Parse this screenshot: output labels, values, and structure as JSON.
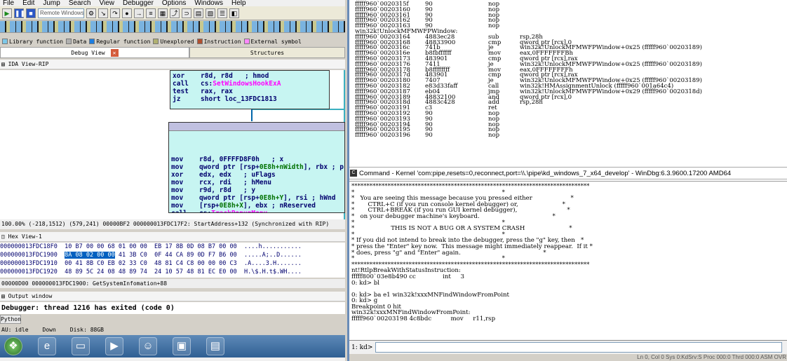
{
  "ida": {
    "menu": [
      "File",
      "Edit",
      "Jump",
      "Search",
      "View",
      "Debugger",
      "Options",
      "Windows",
      "Help"
    ],
    "debugger_select": "Remote Windows debugger",
    "legend": [
      {
        "label": "Library function",
        "color": "#7ec8e8"
      },
      {
        "label": "Data",
        "color": "#b0b0b0"
      },
      {
        "label": "Regular function",
        "color": "#1e7ee0"
      },
      {
        "label": "Unexplored",
        "color": "#b0b070"
      },
      {
        "label": "Instruction",
        "color": "#b05030"
      },
      {
        "label": "External symbol",
        "color": "#ff88ff"
      }
    ],
    "tabs": {
      "debug_view": "Debug View",
      "structures": "Structures",
      "close_glyph": "✕"
    },
    "ida_view_title": "IDA View-RIP",
    "block1": [
      {
        "op": "xor",
        "args": "r8d, r8d",
        "comment": "; hmod"
      },
      {
        "op": "call",
        "args": "cs:",
        "fn": "SetWindowsHookExA"
      },
      {
        "op": "test",
        "args": "rax, rax"
      },
      {
        "op": "jz",
        "args": "short loc_13FDC1813"
      }
    ],
    "block2": [
      {
        "op": "mov",
        "args": "r8d, 0FFFFD8F0h",
        "comment": "; x"
      },
      {
        "op": "mov",
        "args": "qword ptr [rsp+",
        "off": "0E8h+nWidth",
        "rest": "], rbx ; p"
      },
      {
        "op": "xor",
        "args": "edx, edx",
        "comment": "; uFlags"
      },
      {
        "op": "mov",
        "args": "rcx, rdi",
        "comment": "; hMenu"
      },
      {
        "op": "mov",
        "args": "r9d, r8d",
        "comment": "; y"
      },
      {
        "op": "mov",
        "args": "qword ptr [rsp+",
        "off": "0E8h+Y",
        "rest": "], rsi ; hWnd"
      },
      {
        "op": "mov",
        "args": "[rsp+",
        "off": "0E8h+X",
        "rest": "], ebx ; nReserved"
      },
      {
        "op": "call",
        "args": "cs:",
        "fn": "TrackPopupMenu"
      },
      {
        "op": "test",
        "args": "eax, eax"
      },
      {
        "op": "jz",
        "args": "short loc_13FDC1813"
      }
    ],
    "graph_status": "100.00% (-218,1512) (579,241) 00000BF2 000000013FDC17F2: StartAddress+132 (Synchronized with RIP)",
    "hex_title": "Hex View-1",
    "hex_rows": [
      {
        "addr": "000000013FDC18F0",
        "pre": "",
        "hl": "",
        "bytes": "10 B7 00 00 68 01 00 00  EB 17 8B 0D 08 B7 00 00",
        "ascii": "....h..........."
      },
      {
        "addr": "000000013FDC1900",
        "pre": "",
        "hl": "8A 08 02 00 00",
        "bytes": " 41 3B C0  0F 44 CA 89 0D F7 B6 00",
        "ascii": ".....A;..D......"
      },
      {
        "addr": "000000013FDC1910",
        "pre": "",
        "hl": "",
        "bytes": "00 41 8B C0 EB 02 33 C0  48 81 C4 C8 00 00 00 C3",
        "ascii": ".A....3.H......."
      },
      {
        "addr": "000000013FDC1920",
        "pre": "",
        "hl": "",
        "bytes": "48 89 5C 24 08 48 89 74  24 10 57 48 81 EC E0 00",
        "ascii": "H.\\$.H.t$.WH...."
      }
    ],
    "hex_status": "00000D00 000000013FDC1900: GetSystemInfomation+88",
    "output_title": "Output window",
    "output_text": "Debugger: thread 1216 has exited (code 0)",
    "python_button": "Python",
    "status": {
      "au": "AU:  idle",
      "down": "Down",
      "disk": "Disk: 88GB"
    }
  },
  "windbg": {
    "disasm": [
      {
        "addr": "fffff960`0020315f",
        "bytes": "90",
        "mn": "nop",
        "ops": ""
      },
      {
        "addr": "fffff960`00203160",
        "bytes": "90",
        "mn": "nop",
        "ops": ""
      },
      {
        "addr": "fffff960`00203161",
        "bytes": "90",
        "mn": "nop",
        "ops": ""
      },
      {
        "addr": "fffff960`00203162",
        "bytes": "90",
        "mn": "nop",
        "ops": ""
      },
      {
        "addr": "fffff960`00203163",
        "bytes": "90",
        "mn": "nop",
        "ops": ""
      },
      {
        "sym": "win32k!UnlockMFMWFPWindow:"
      },
      {
        "addr": "fffff960`00203164",
        "bytes": "4883ec28",
        "mn": "sub",
        "ops": "rsp,28h"
      },
      {
        "addr": "fffff960`00203168",
        "bytes": "48833900",
        "mn": "cmp",
        "ops": "qword ptr [rcx],0"
      },
      {
        "addr": "fffff960`0020316c",
        "bytes": "741b",
        "mn": "je",
        "ops": "win32k!UnlockMFMWFPWindow+0x25 (fffff960`00203189)"
      },
      {
        "addr": "fffff960`0020316e",
        "bytes": "b8fbffffff",
        "mn": "mov",
        "ops": "eax,0FFFFFFFBh"
      },
      {
        "addr": "fffff960`00203173",
        "bytes": "483901",
        "mn": "cmp",
        "ops": "qword ptr [rcx],rax"
      },
      {
        "addr": "fffff960`00203176",
        "bytes": "7411",
        "mn": "je",
        "ops": "win32k!UnlockMFMWFPWindow+0x25 (fffff960`00203189)"
      },
      {
        "addr": "fffff960`00203178",
        "bytes": "b8ffffffff",
        "mn": "mov",
        "ops": "eax,0FFFFFFFFh"
      },
      {
        "addr": "fffff960`0020317d",
        "bytes": "483901",
        "mn": "cmp",
        "ops": "qword ptr [rcx],rax"
      },
      {
        "addr": "fffff960`00203180",
        "bytes": "7407",
        "mn": "je",
        "ops": "win32k!UnlockMFMWFPWindow+0x25 (fffff960`00203189)"
      },
      {
        "addr": "fffff960`00203182",
        "bytes": "e83d33faff",
        "mn": "call",
        "ops": "win32k!HMAssignmentUnlock (fffff960`001a64c4)"
      },
      {
        "addr": "fffff960`00203187",
        "bytes": "eb04",
        "mn": "jmp",
        "ops": "win32k!UnlockMFMWFPWindow+0x29 (fffff960`0020318d)"
      },
      {
        "addr": "fffff960`00203189",
        "bytes": "48832100",
        "mn": "and",
        "ops": "qword ptr [rcx],0"
      },
      {
        "addr": "fffff960`0020318d",
        "bytes": "4883c428",
        "mn": "add",
        "ops": "rsp,28h"
      },
      {
        "addr": "fffff960`00203191",
        "bytes": "c3",
        "mn": "ret",
        "ops": ""
      },
      {
        "addr": "fffff960`00203192",
        "bytes": "90",
        "mn": "nop",
        "ops": ""
      },
      {
        "addr": "fffff960`00203193",
        "bytes": "90",
        "mn": "nop",
        "ops": ""
      },
      {
        "addr": "fffff960`00203194",
        "bytes": "90",
        "mn": "nop",
        "ops": ""
      },
      {
        "addr": "fffff960`00203195",
        "bytes": "90",
        "mn": "nop",
        "ops": ""
      },
      {
        "addr": "fffff960`00203196",
        "bytes": "90",
        "mn": "nop",
        "ops": ""
      }
    ],
    "command_title": "Command - Kernel 'com:pipe,resets=0,reconnect,port=\\\\.\\pipe\\kd_windows_7_x64_develop' - WinDbg:6.3.9600.17200 AMD64",
    "command_lines": [
      "*******************************************************************************",
      "*                                                                             *",
      "*   You are seeing this message because you pressed either                    *",
      "*       CTRL+C (if you run console kernel debugger) or,                       *",
      "*       CTRL+BREAK (if you run GUI kernel debugger),                          *",
      "*   on your debugger machine's keyboard.                                      *",
      "*                                                                             *",
      "*                   THIS IS NOT A BUG OR A SYSTEM CRASH                       *",
      "*                                                                             *",
      "* If you did not intend to break into the debugger, press the \"g\" key, then   *",
      "* press the \"Enter\" key now.  This message might immediately reappear.  If it *",
      "* does, press \"g\" and \"Enter\" again.                                           *",
      "*                                                                             *",
      "*******************************************************************************",
      "nt!RtlpBreakWithStatusInstruction:",
      "fffff800`03e8b490 cc              int     3",
      "0: kd> bl",
      "",
      "0: kd> ba e1 win32k!xxxMNFindWindowFromPoint",
      "0: kd> g",
      "Breakpoint 0 hit",
      "win32k!xxxMNFindWindowFromPoint:",
      "fffff960`00203198 4c8bdc          mov     r11,rsp"
    ],
    "prompt": "1: kd>",
    "status": "Ln 0, Col 0   Sys 0:KdSrv:S   Proc 000:0   Thrd 000:0   ASM   OVR"
  }
}
